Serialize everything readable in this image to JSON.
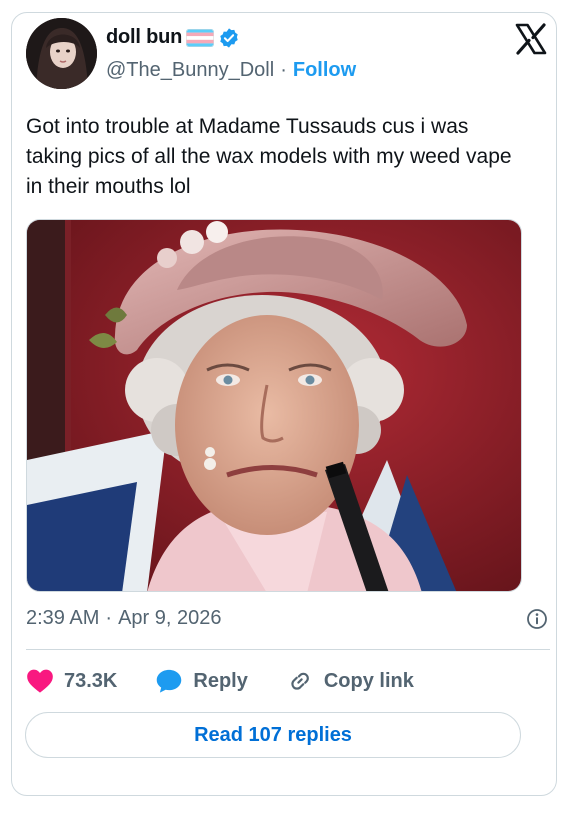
{
  "author": {
    "display_name": "doll bun",
    "handle": "@The_Bunny_Doll",
    "separator": "·",
    "follow_label": "Follow"
  },
  "tweet": {
    "text": "Got into trouble at Madame Tussauds cus i was taking pics of all the wax models with my weed vape in their mouths lol",
    "time": "2:39 AM",
    "date": "Apr 9, 2026"
  },
  "actions": {
    "likes": "73.3K",
    "reply_label": "Reply",
    "copy_link_label": "Copy link",
    "read_replies_label": "Read 107 replies"
  },
  "colors": {
    "accent": "#1d9bf0",
    "like": "#f91880",
    "link_button_text": "#006fd6",
    "muted": "#536471",
    "border": "#cfd9de"
  },
  "icons": [
    "verified-badge-icon",
    "trans-flag-icon",
    "x-logo-icon",
    "info-icon",
    "heart-icon",
    "reply-bubble-icon",
    "link-icon"
  ]
}
